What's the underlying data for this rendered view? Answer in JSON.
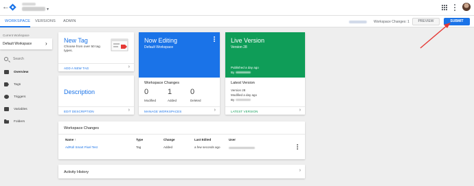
{
  "topbar": {
    "back_glyph": "←",
    "logo_icon": "gtm-diamond-icon",
    "caret_glyph": "▾",
    "colors": {
      "brand_blue": "#1a73e8",
      "brand_green": "#0f9d58"
    }
  },
  "tabs": [
    {
      "label": "WORKSPACE",
      "active": true
    },
    {
      "label": "VERSIONS",
      "active": false
    },
    {
      "label": "ADMIN",
      "active": false
    }
  ],
  "toolbar": {
    "workspace_changes": "Workspace Changes: 1",
    "preview_label": "PREVIEW",
    "submit_label": "SUBMIT"
  },
  "sidebar": {
    "current_workspace_label": "Current Workspace",
    "workspace_name": "Default Workspace",
    "chevron_glyph": "›",
    "search_placeholder": "Search",
    "items": [
      {
        "label": "Overview",
        "icon": "overview-icon",
        "active": true
      },
      {
        "label": "Tags",
        "icon": "tag-icon",
        "active": false
      },
      {
        "label": "Triggers",
        "icon": "trigger-icon",
        "active": false
      },
      {
        "label": "Variables",
        "icon": "variable-icon",
        "active": false
      },
      {
        "label": "Folders",
        "icon": "folder-icon",
        "active": false
      }
    ]
  },
  "new_tag": {
    "title": "New Tag",
    "desc": "Choose from over 50 tag types.",
    "link": "ADD A NEW TAG"
  },
  "description_card": {
    "title": "Description",
    "link": "EDIT DESCRIPTION"
  },
  "now_editing": {
    "title": "Now Editing",
    "subtitle": "Default Workspace",
    "section_title": "Workspace Changes",
    "stats": [
      {
        "num": "0",
        "label": "Modified"
      },
      {
        "num": "1",
        "label": "Added"
      },
      {
        "num": "0",
        "label": "Deleted"
      }
    ],
    "link": "MANAGE WORKSPACES"
  },
  "live_version": {
    "title": "Live Version",
    "subtitle": "Version 28",
    "published": "Published a day ago",
    "by": "By",
    "section_title": "Latest Version",
    "latest_version": "Version 28",
    "modified": "Modified a day ago",
    "latest_by": "By",
    "link": "LATEST VERSION"
  },
  "changes_table": {
    "title": "Workspace Changes",
    "columns": [
      "Name",
      "Type",
      "Change",
      "Last Edited",
      "User"
    ],
    "sort_glyph": "↑",
    "rows": [
      {
        "name": "AdRoll Smart Pixel Test",
        "type": "Tag",
        "change": "Added",
        "last_edited": "a few seconds ago"
      }
    ]
  },
  "activity": {
    "title": "Activity History",
    "chevron_glyph": "›"
  }
}
